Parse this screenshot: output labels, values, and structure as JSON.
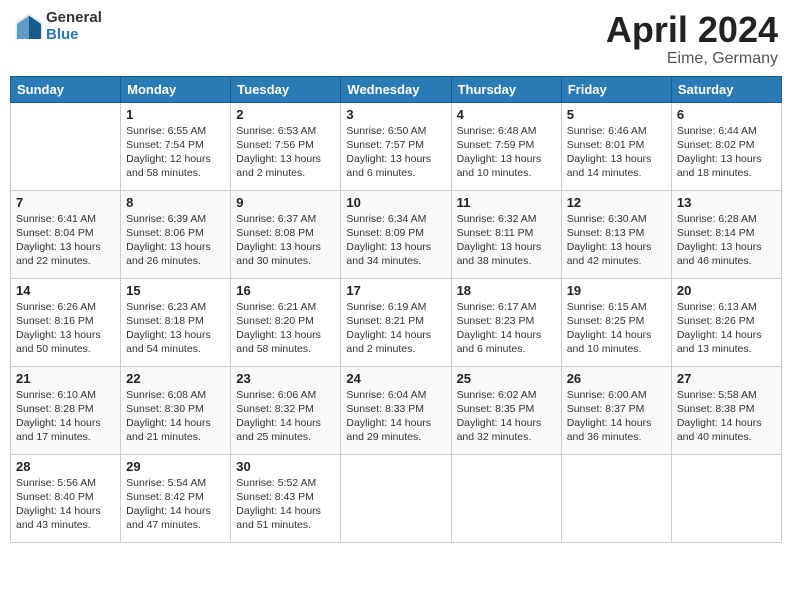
{
  "header": {
    "logo_general": "General",
    "logo_blue": "Blue",
    "month": "April 2024",
    "location": "Eime, Germany"
  },
  "weekdays": [
    "Sunday",
    "Monday",
    "Tuesday",
    "Wednesday",
    "Thursday",
    "Friday",
    "Saturday"
  ],
  "weeks": [
    [
      {
        "num": "",
        "info": ""
      },
      {
        "num": "1",
        "info": "Sunrise: 6:55 AM\nSunset: 7:54 PM\nDaylight: 12 hours\nand 58 minutes."
      },
      {
        "num": "2",
        "info": "Sunrise: 6:53 AM\nSunset: 7:56 PM\nDaylight: 13 hours\nand 2 minutes."
      },
      {
        "num": "3",
        "info": "Sunrise: 6:50 AM\nSunset: 7:57 PM\nDaylight: 13 hours\nand 6 minutes."
      },
      {
        "num": "4",
        "info": "Sunrise: 6:48 AM\nSunset: 7:59 PM\nDaylight: 13 hours\nand 10 minutes."
      },
      {
        "num": "5",
        "info": "Sunrise: 6:46 AM\nSunset: 8:01 PM\nDaylight: 13 hours\nand 14 minutes."
      },
      {
        "num": "6",
        "info": "Sunrise: 6:44 AM\nSunset: 8:02 PM\nDaylight: 13 hours\nand 18 minutes."
      }
    ],
    [
      {
        "num": "7",
        "info": "Sunrise: 6:41 AM\nSunset: 8:04 PM\nDaylight: 13 hours\nand 22 minutes."
      },
      {
        "num": "8",
        "info": "Sunrise: 6:39 AM\nSunset: 8:06 PM\nDaylight: 13 hours\nand 26 minutes."
      },
      {
        "num": "9",
        "info": "Sunrise: 6:37 AM\nSunset: 8:08 PM\nDaylight: 13 hours\nand 30 minutes."
      },
      {
        "num": "10",
        "info": "Sunrise: 6:34 AM\nSunset: 8:09 PM\nDaylight: 13 hours\nand 34 minutes."
      },
      {
        "num": "11",
        "info": "Sunrise: 6:32 AM\nSunset: 8:11 PM\nDaylight: 13 hours\nand 38 minutes."
      },
      {
        "num": "12",
        "info": "Sunrise: 6:30 AM\nSunset: 8:13 PM\nDaylight: 13 hours\nand 42 minutes."
      },
      {
        "num": "13",
        "info": "Sunrise: 6:28 AM\nSunset: 8:14 PM\nDaylight: 13 hours\nand 46 minutes."
      }
    ],
    [
      {
        "num": "14",
        "info": "Sunrise: 6:26 AM\nSunset: 8:16 PM\nDaylight: 13 hours\nand 50 minutes."
      },
      {
        "num": "15",
        "info": "Sunrise: 6:23 AM\nSunset: 8:18 PM\nDaylight: 13 hours\nand 54 minutes."
      },
      {
        "num": "16",
        "info": "Sunrise: 6:21 AM\nSunset: 8:20 PM\nDaylight: 13 hours\nand 58 minutes."
      },
      {
        "num": "17",
        "info": "Sunrise: 6:19 AM\nSunset: 8:21 PM\nDaylight: 14 hours\nand 2 minutes."
      },
      {
        "num": "18",
        "info": "Sunrise: 6:17 AM\nSunset: 8:23 PM\nDaylight: 14 hours\nand 6 minutes."
      },
      {
        "num": "19",
        "info": "Sunrise: 6:15 AM\nSunset: 8:25 PM\nDaylight: 14 hours\nand 10 minutes."
      },
      {
        "num": "20",
        "info": "Sunrise: 6:13 AM\nSunset: 8:26 PM\nDaylight: 14 hours\nand 13 minutes."
      }
    ],
    [
      {
        "num": "21",
        "info": "Sunrise: 6:10 AM\nSunset: 8:28 PM\nDaylight: 14 hours\nand 17 minutes."
      },
      {
        "num": "22",
        "info": "Sunrise: 6:08 AM\nSunset: 8:30 PM\nDaylight: 14 hours\nand 21 minutes."
      },
      {
        "num": "23",
        "info": "Sunrise: 6:06 AM\nSunset: 8:32 PM\nDaylight: 14 hours\nand 25 minutes."
      },
      {
        "num": "24",
        "info": "Sunrise: 6:04 AM\nSunset: 8:33 PM\nDaylight: 14 hours\nand 29 minutes."
      },
      {
        "num": "25",
        "info": "Sunrise: 6:02 AM\nSunset: 8:35 PM\nDaylight: 14 hours\nand 32 minutes."
      },
      {
        "num": "26",
        "info": "Sunrise: 6:00 AM\nSunset: 8:37 PM\nDaylight: 14 hours\nand 36 minutes."
      },
      {
        "num": "27",
        "info": "Sunrise: 5:58 AM\nSunset: 8:38 PM\nDaylight: 14 hours\nand 40 minutes."
      }
    ],
    [
      {
        "num": "28",
        "info": "Sunrise: 5:56 AM\nSunset: 8:40 PM\nDaylight: 14 hours\nand 43 minutes."
      },
      {
        "num": "29",
        "info": "Sunrise: 5:54 AM\nSunset: 8:42 PM\nDaylight: 14 hours\nand 47 minutes."
      },
      {
        "num": "30",
        "info": "Sunrise: 5:52 AM\nSunset: 8:43 PM\nDaylight: 14 hours\nand 51 minutes."
      },
      {
        "num": "",
        "info": ""
      },
      {
        "num": "",
        "info": ""
      },
      {
        "num": "",
        "info": ""
      },
      {
        "num": "",
        "info": ""
      }
    ]
  ]
}
